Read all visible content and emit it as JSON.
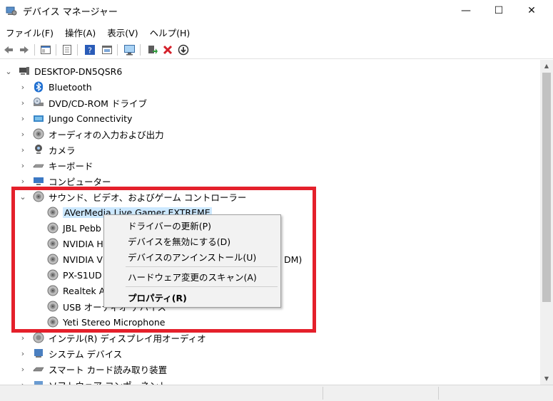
{
  "window": {
    "title": "デバイス マネージャー",
    "minimize_label": "—",
    "maximize_label": "☐",
    "close_label": "✕"
  },
  "menu": [
    "ファイル(F)",
    "操作(A)",
    "表示(V)",
    "ヘルプ(H)"
  ],
  "toolbar": {
    "icons": [
      "back-arrow-icon",
      "forward-arrow-icon",
      "properties-panel-icon",
      "device-list-icon",
      "help-icon",
      "view-icon",
      "monitor-icon",
      "update-driver-icon",
      "uninstall-x-icon",
      "download-icon"
    ]
  },
  "tree": {
    "root": "DESKTOP-DN5QSR6",
    "categories": [
      {
        "label": "Bluetooth",
        "icon": "bluetooth-icon"
      },
      {
        "label": "DVD/CD-ROM ドライブ",
        "icon": "dvd-drive-icon"
      },
      {
        "label": "Jungo Connectivity",
        "icon": "network-icon"
      },
      {
        "label": "オーディオの入力および出力",
        "icon": "speaker-icon"
      },
      {
        "label": "カメラ",
        "icon": "camera-icon"
      },
      {
        "label": "キーボード",
        "icon": "keyboard-icon"
      },
      {
        "label": "コンピューター",
        "icon": "computer-icon"
      }
    ],
    "expanded_category": "サウンド、ビデオ、およびゲーム コントローラー",
    "devices": [
      "AVerMedia Live Gamer EXTREME",
      "JBL Pebb",
      "NVIDIA H",
      "NVIDIA V",
      "PX-S1UD",
      "Realtek A",
      "USB オーディオ デバイス",
      "Yeti Stereo Microphone"
    ],
    "partial_suffix_nvidia_v": "DM)",
    "after_categories": [
      {
        "label": "インテル(R) ディスプレイ用オーディオ",
        "icon": "speaker-icon"
      },
      {
        "label": "システム デバイス",
        "icon": "system-device-icon"
      },
      {
        "label": "スマート カード読み取り装置",
        "icon": "smart-card-icon"
      },
      {
        "label": "ソフトウェア コンポーネント",
        "icon": "software-component-icon"
      }
    ]
  },
  "context_menu": {
    "items": [
      "ドライバーの更新(P)",
      "デバイスを無効にする(D)",
      "デバイスのアンインストール(U)",
      "ハードウェア変更のスキャン(A)",
      "プロパティ(R)"
    ]
  },
  "colors": {
    "highlight_border": "#e4202b",
    "selection": "#cce8ff"
  }
}
